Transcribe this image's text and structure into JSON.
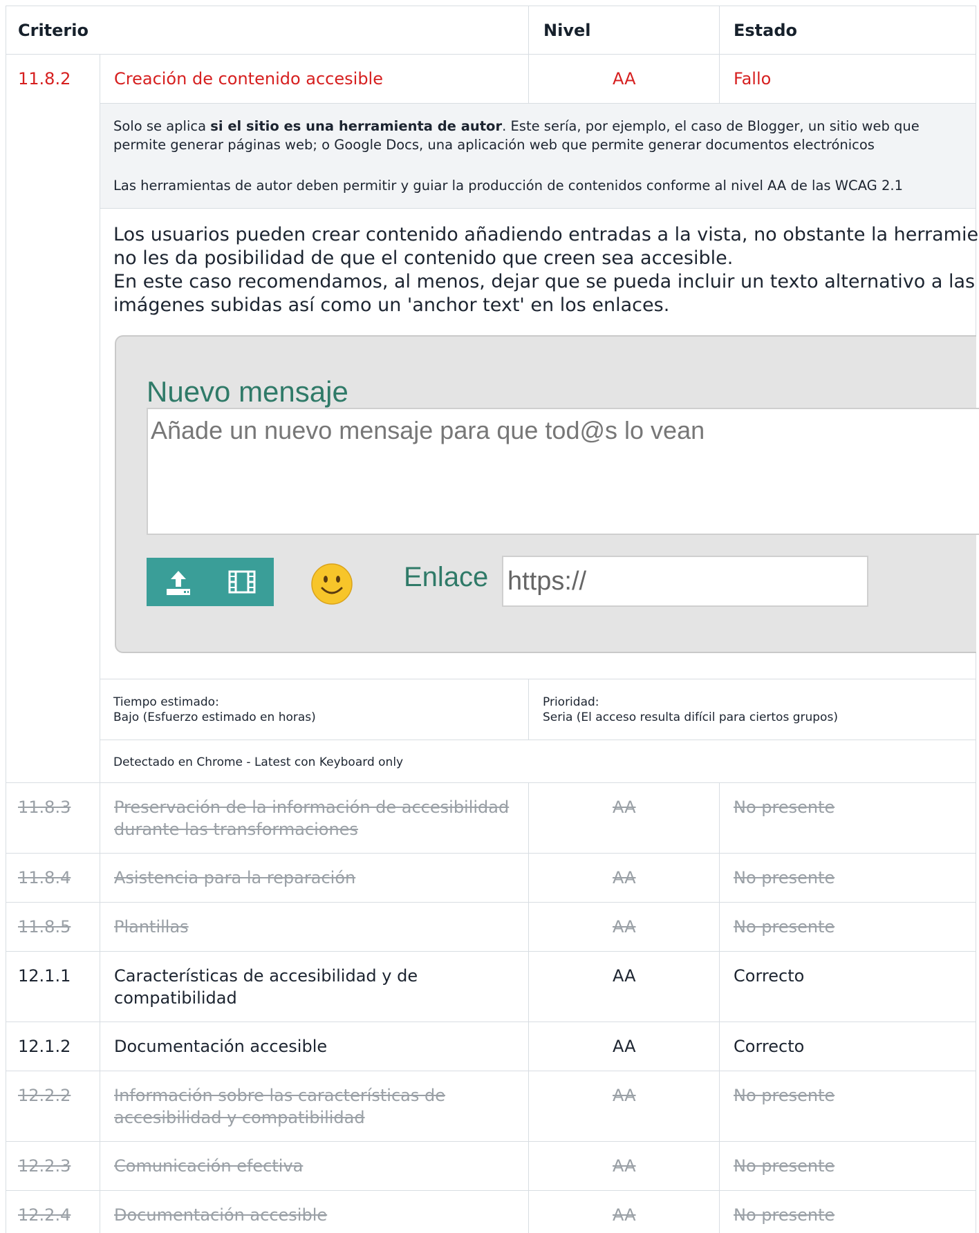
{
  "header": {
    "criterio": "Criterio",
    "nivel": "Nivel",
    "estado": "Estado"
  },
  "expanded": {
    "id": "11.8.2",
    "title": "Creación de contenido accesible",
    "level": "AA",
    "status": "Fallo",
    "desc_line1_pre": "Solo se aplica ",
    "desc_line1_bold": "si el sitio es una herramienta de autor",
    "desc_line1_post": ". Este sería, por ejemplo, el caso de Blogger, un sitio web que",
    "desc_line2": "permite generar páginas web; o Google Docs, una aplicación web que permite generar documentos electrónicos",
    "desc_line3": "Las herramientas de autor deben permitir y guiar la producción de contenidos conforme al nivel AA de las WCAG 2.1",
    "finding_lines": [
      "Los usuarios pueden crear contenido añadiendo entradas a la vista, no obstante la herramienta",
      "no les da posibilidad de que el contenido que creen sea accesible.",
      "En este caso recomendamos, al menos, dejar que se pueda incluir un texto alternativo a las",
      "imágenes subidas así como un 'anchor text' en los enlaces."
    ],
    "screenshot": {
      "title": "Nuevo mensaje",
      "placeholder": "Añade un nuevo mensaje para que tod@s lo vean",
      "link_label": "Enlace",
      "link_value": "https://",
      "icons": [
        "upload-icon",
        "film-icon",
        "smiley-icon"
      ],
      "accent": "#3a9e98"
    },
    "time_label": "Tiempo estimado:",
    "time_value": "Bajo (Esfuerzo estimado en horas)",
    "priority_label": "Prioridad:",
    "priority_value": "Seria (El acceso resulta difícil para ciertos grupos)",
    "detected": "Detectado en Chrome - Latest con Keyboard only"
  },
  "rows": [
    {
      "id": "11.8.3",
      "title1": "Preservación de la información de accesibilidad",
      "title2": "durante las transformaciones",
      "level": "AA",
      "status": "No presente"
    },
    {
      "id": "11.8.4",
      "title1": "Asistencia para la reparación",
      "title2": "",
      "level": "AA",
      "status": "No presente"
    },
    {
      "id": "11.8.5",
      "title1": "Plantillas",
      "title2": "",
      "level": "AA",
      "status": "No presente"
    },
    {
      "id": "12.1.1",
      "title1": "Características de accesibilidad y de",
      "title2": "compatibilidad",
      "level": "AA",
      "status": "Correcto"
    },
    {
      "id": "12.1.2",
      "title1": "Documentación accesible",
      "title2": "",
      "level": "AA",
      "status": "Correcto"
    },
    {
      "id": "12.2.2",
      "title1": "Información sobre las características de",
      "title2": "accesibilidad y compatibilidad",
      "level": "AA",
      "status": "No presente"
    },
    {
      "id": "12.2.3",
      "title1": "Comunicación efectiva",
      "title2": "",
      "level": "AA",
      "status": "No presente"
    },
    {
      "id": "12.2.4",
      "title1": "Documentación accesible",
      "title2": "",
      "level": "AA",
      "status": "No presente"
    }
  ],
  "colors": {
    "fail": "#d61f1f",
    "na": "#9aa0a6",
    "border": "#d8dde2"
  }
}
